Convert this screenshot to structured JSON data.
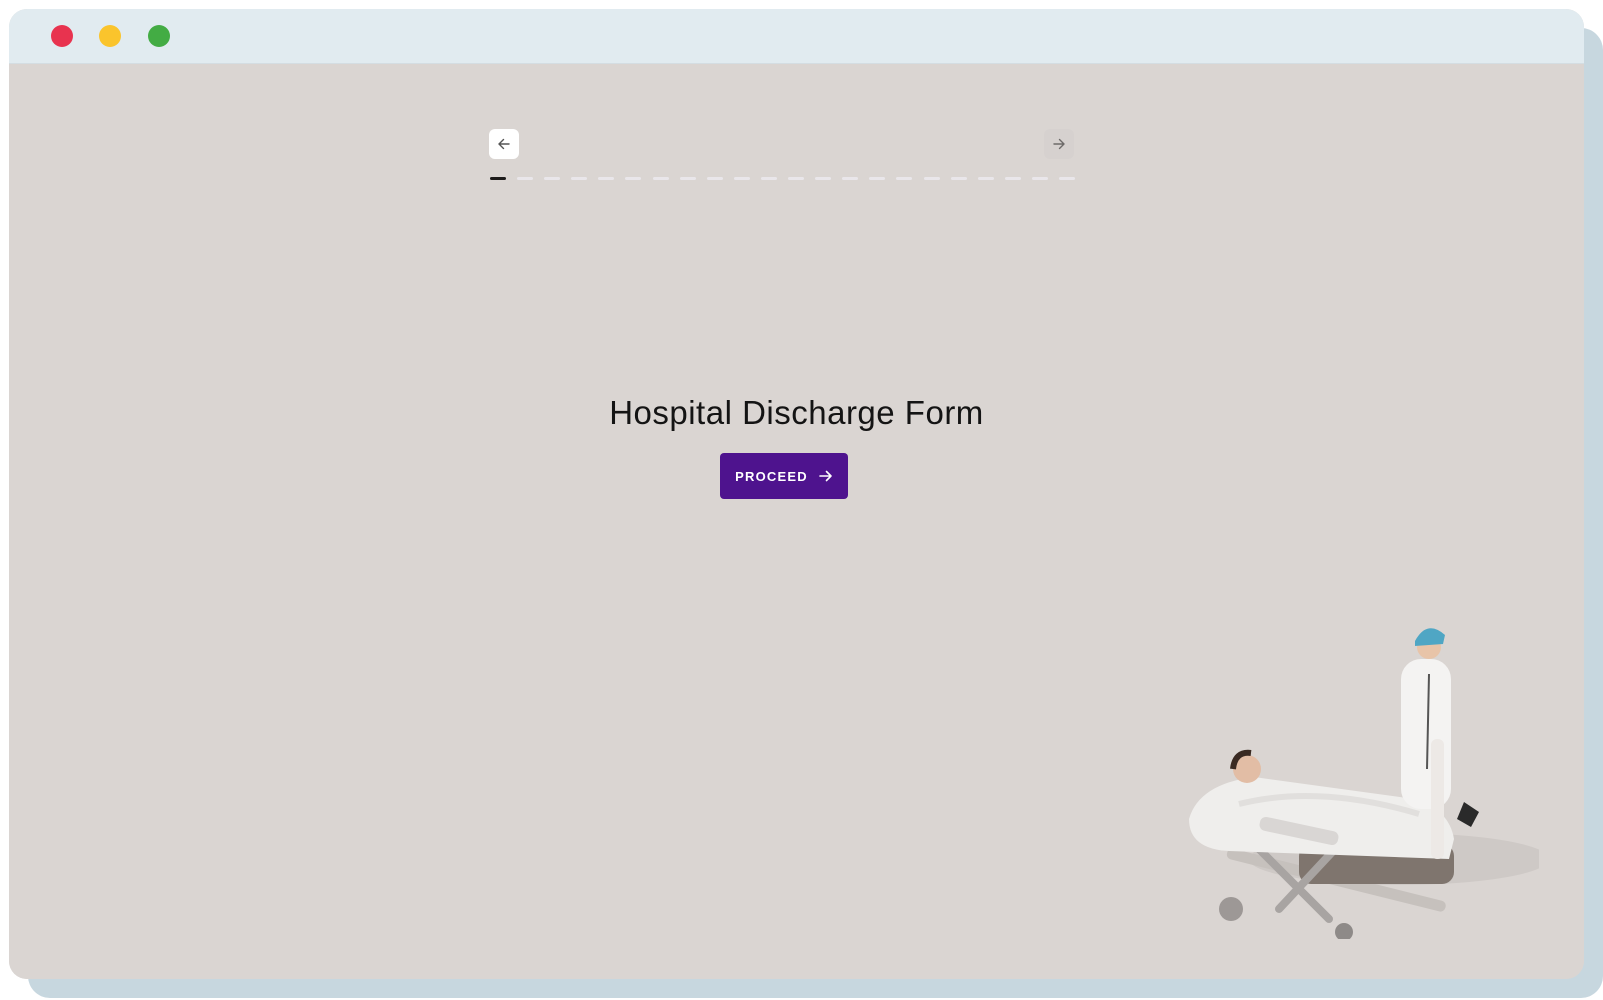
{
  "window": {
    "controls": [
      "close",
      "minimize",
      "maximize"
    ],
    "colors": {
      "close": "#e8334f",
      "minimize": "#fac42c",
      "maximize": "#43ac44"
    }
  },
  "nav": {
    "back_icon": "arrow-left-icon",
    "next_icon": "arrow-right-icon"
  },
  "progress": {
    "total_steps": 22,
    "current_step": 1
  },
  "main": {
    "title": "Hospital Discharge Form",
    "proceed_label": "PROCEED",
    "proceed_icon": "arrow-right-icon"
  },
  "illustration": {
    "name": "doctor-with-patient-on-stretcher"
  },
  "colors": {
    "background": "#dad5d2",
    "titlebar": "#e1ebf0",
    "accent": "#4e138e",
    "progress_active": "#1d1b1a",
    "progress_inactive": "#e9e6ea"
  }
}
